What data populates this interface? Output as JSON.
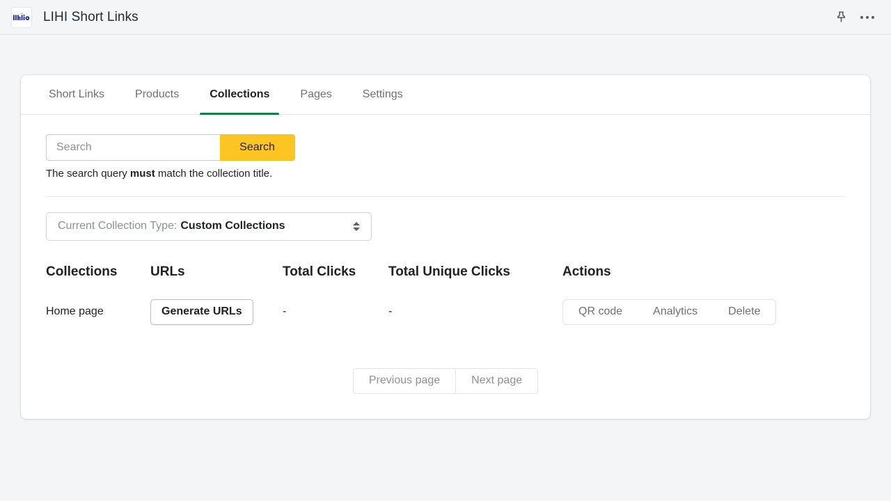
{
  "appbar": {
    "logo_icon": "lihi-logo-icon",
    "logo_text": "lihi.io",
    "title": "LIHI Short Links",
    "pin_icon": "pin-icon",
    "more_icon": "more-options-icon"
  },
  "tabs": [
    {
      "label": "Short Links",
      "name": "tab-short-links",
      "active": false
    },
    {
      "label": "Products",
      "name": "tab-products",
      "active": false
    },
    {
      "label": "Collections",
      "name": "tab-collections",
      "active": true
    },
    {
      "label": "Pages",
      "name": "tab-pages",
      "active": false
    },
    {
      "label": "Settings",
      "name": "tab-settings",
      "active": false
    }
  ],
  "search": {
    "placeholder": "Search",
    "value": "",
    "button_label": "Search",
    "button_color": "#fcc521",
    "helper_prefix": "The search query ",
    "helper_bold": "must",
    "helper_suffix": " match the collection title."
  },
  "collection_type_select": {
    "label": "Current Collection Type:",
    "value": "Custom Collections",
    "caret_icon": "chevron-up-down-icon"
  },
  "table": {
    "headers": {
      "collections": "Collections",
      "urls": "URLs",
      "total_clicks": "Total Clicks",
      "total_unique_clicks": "Total Unique Clicks",
      "actions": "Actions"
    },
    "rows": [
      {
        "collection": "Home page",
        "urls_button": "Generate URLs",
        "total_clicks": "-",
        "total_unique_clicks": "-",
        "actions": [
          {
            "label": "QR code",
            "name": "qr-code-button"
          },
          {
            "label": "Analytics",
            "name": "analytics-button"
          },
          {
            "label": "Delete",
            "name": "delete-button"
          }
        ]
      }
    ]
  },
  "pagination": {
    "previous_label": "Previous page",
    "next_label": "Next page"
  },
  "theme": {
    "page_background": "#f4f5f6",
    "card_background": "#ffffff",
    "active_tab_accent": "#108043",
    "primary_button": "#fcc521"
  }
}
